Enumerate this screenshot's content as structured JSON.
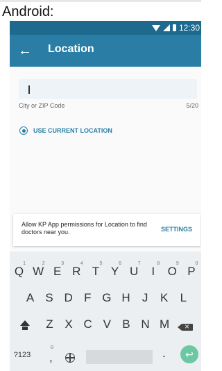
{
  "caption": "Android:",
  "status": {
    "time": "12:30"
  },
  "appbar": {
    "back_glyph": "←",
    "title": "Location"
  },
  "field": {
    "label": "City or ZIP Code",
    "counter": "5/20"
  },
  "use_current": {
    "label": "USE CURRENT LOCATION"
  },
  "snackbar": {
    "message": "Allow KP App permissions for Location to find doctors near you.",
    "action": "SETTINGS"
  },
  "keyboard": {
    "row1": [
      {
        "k": "Q",
        "h": "1"
      },
      {
        "k": "W",
        "h": "2"
      },
      {
        "k": "E",
        "h": "3"
      },
      {
        "k": "R",
        "h": "4"
      },
      {
        "k": "T",
        "h": "5"
      },
      {
        "k": "Y",
        "h": "6"
      },
      {
        "k": "U",
        "h": "7"
      },
      {
        "k": "I",
        "h": "8"
      },
      {
        "k": "O",
        "h": "9"
      },
      {
        "k": "P",
        "h": "0"
      }
    ],
    "row2": [
      "A",
      "S",
      "D",
      "F",
      "G",
      "H",
      "J",
      "K",
      "L"
    ],
    "row3": [
      "Z",
      "X",
      "C",
      "V",
      "B",
      "N",
      "M"
    ],
    "sym": "?123",
    "comma": ",",
    "period": ".",
    "enter_glyph": "↩",
    "emoji_hint": "☺"
  }
}
